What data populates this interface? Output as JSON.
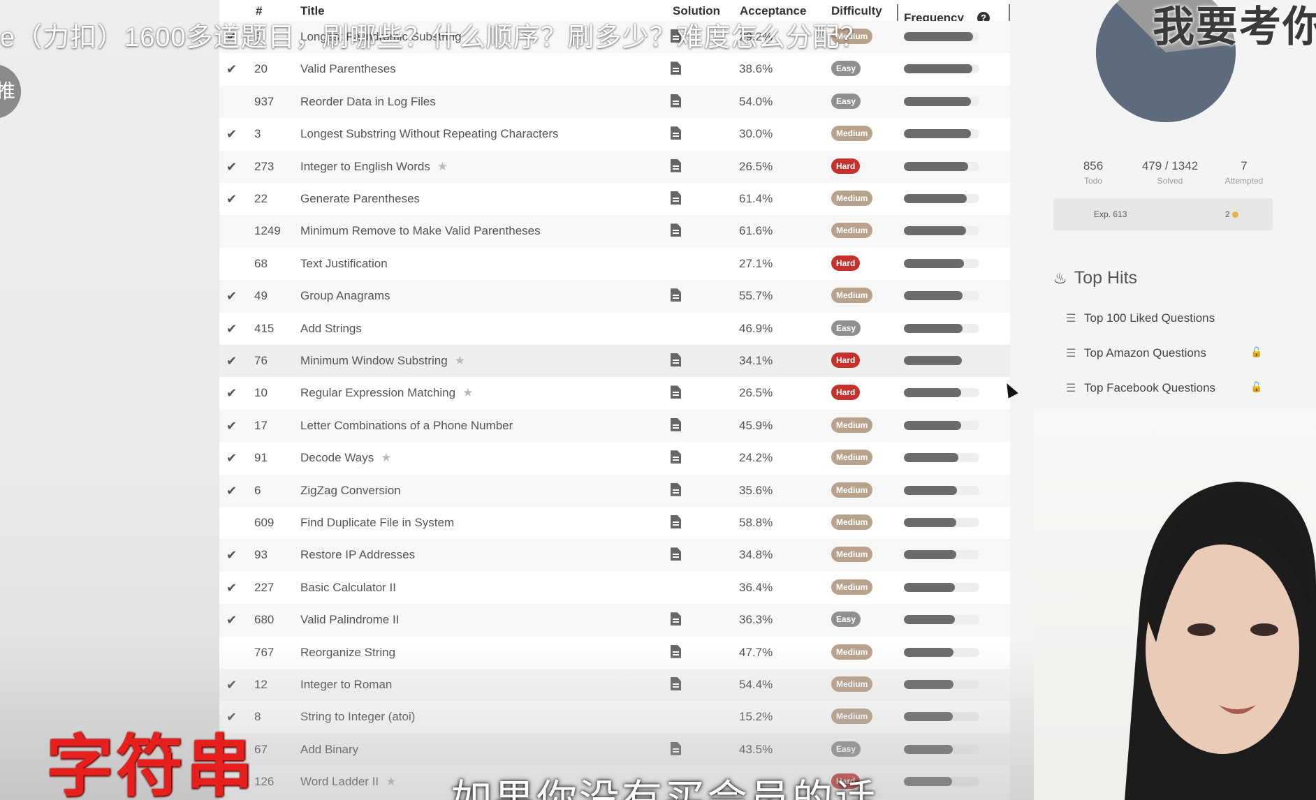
{
  "video": {
    "title_overlay": "e（力扣）1600多道题目，刷哪些？什么顺序？刷多少？难度怎么分配？",
    "side_button_char": "推",
    "top_right_caption": "我要考你",
    "red_caption": "字符串",
    "bottom_caption": "如果你没有买会员的话"
  },
  "table": {
    "headers": {
      "num": "#",
      "title": "Title",
      "solution": "Solution",
      "acceptance": "Acceptance",
      "difficulty": "Difficulty",
      "frequency": "Frequency",
      "frequency_help_icon": "question-circle-icon"
    },
    "rows": [
      {
        "solved": true,
        "num": "5",
        "title": "Longest Palindromic Substring",
        "starred": false,
        "solution": true,
        "acceptance": "29.2%",
        "difficulty": "Medium",
        "frequency": 0.92
      },
      {
        "solved": true,
        "num": "20",
        "title": "Valid Parentheses",
        "starred": false,
        "solution": true,
        "acceptance": "38.6%",
        "difficulty": "Easy",
        "frequency": 0.91
      },
      {
        "solved": false,
        "num": "937",
        "title": "Reorder Data in Log Files",
        "starred": false,
        "solution": true,
        "acceptance": "54.0%",
        "difficulty": "Easy",
        "frequency": 0.89
      },
      {
        "solved": true,
        "num": "3",
        "title": "Longest Substring Without Repeating Characters",
        "starred": false,
        "solution": true,
        "acceptance": "30.0%",
        "difficulty": "Medium",
        "frequency": 0.89
      },
      {
        "solved": true,
        "num": "273",
        "title": "Integer to English Words",
        "starred": true,
        "solution": true,
        "acceptance": "26.5%",
        "difficulty": "Hard",
        "frequency": 0.85
      },
      {
        "solved": true,
        "num": "22",
        "title": "Generate Parentheses",
        "starred": false,
        "solution": true,
        "acceptance": "61.4%",
        "difficulty": "Medium",
        "frequency": 0.83
      },
      {
        "solved": false,
        "num": "1249",
        "title": "Minimum Remove to Make Valid Parentheses",
        "starred": false,
        "solution": true,
        "acceptance": "61.6%",
        "difficulty": "Medium",
        "frequency": 0.82
      },
      {
        "solved": false,
        "num": "68",
        "title": "Text Justification",
        "starred": false,
        "solution": false,
        "acceptance": "27.1%",
        "difficulty": "Hard",
        "frequency": 0.8
      },
      {
        "solved": true,
        "num": "49",
        "title": "Group Anagrams",
        "starred": false,
        "solution": true,
        "acceptance": "55.7%",
        "difficulty": "Medium",
        "frequency": 0.78
      },
      {
        "solved": true,
        "num": "415",
        "title": "Add Strings",
        "starred": false,
        "solution": false,
        "acceptance": "46.9%",
        "difficulty": "Easy",
        "frequency": 0.78
      },
      {
        "solved": true,
        "num": "76",
        "title": "Minimum Window Substring",
        "starred": true,
        "solution": true,
        "acceptance": "34.1%",
        "difficulty": "Hard",
        "frequency": 0.77
      },
      {
        "solved": true,
        "num": "10",
        "title": "Regular Expression Matching",
        "starred": true,
        "solution": true,
        "acceptance": "26.5%",
        "difficulty": "Hard",
        "frequency": 0.76
      },
      {
        "solved": true,
        "num": "17",
        "title": "Letter Combinations of a Phone Number",
        "starred": false,
        "solution": true,
        "acceptance": "45.9%",
        "difficulty": "Medium",
        "frequency": 0.76
      },
      {
        "solved": true,
        "num": "91",
        "title": "Decode Ways",
        "starred": true,
        "solution": true,
        "acceptance": "24.2%",
        "difficulty": "Medium",
        "frequency": 0.72
      },
      {
        "solved": true,
        "num": "6",
        "title": "ZigZag Conversion",
        "starred": false,
        "solution": true,
        "acceptance": "35.6%",
        "difficulty": "Medium",
        "frequency": 0.7
      },
      {
        "solved": false,
        "num": "609",
        "title": "Find Duplicate File in System",
        "starred": false,
        "solution": true,
        "acceptance": "58.8%",
        "difficulty": "Medium",
        "frequency": 0.69
      },
      {
        "solved": true,
        "num": "93",
        "title": "Restore IP Addresses",
        "starred": false,
        "solution": true,
        "acceptance": "34.8%",
        "difficulty": "Medium",
        "frequency": 0.69
      },
      {
        "solved": true,
        "num": "227",
        "title": "Basic Calculator II",
        "starred": false,
        "solution": false,
        "acceptance": "36.4%",
        "difficulty": "Medium",
        "frequency": 0.68
      },
      {
        "solved": true,
        "num": "680",
        "title": "Valid Palindrome II",
        "starred": false,
        "solution": true,
        "acceptance": "36.3%",
        "difficulty": "Easy",
        "frequency": 0.68
      },
      {
        "solved": false,
        "num": "767",
        "title": "Reorganize String",
        "starred": false,
        "solution": true,
        "acceptance": "47.7%",
        "difficulty": "Medium",
        "frequency": 0.66
      },
      {
        "solved": true,
        "num": "12",
        "title": "Integer to Roman",
        "starred": false,
        "solution": true,
        "acceptance": "54.4%",
        "difficulty": "Medium",
        "frequency": 0.66
      },
      {
        "solved": true,
        "num": "8",
        "title": "String to Integer (atoi)",
        "starred": false,
        "solution": false,
        "acceptance": "15.2%",
        "difficulty": "Medium",
        "frequency": 0.65
      },
      {
        "solved": false,
        "num": "67",
        "title": "Add Binary",
        "starred": false,
        "solution": true,
        "acceptance": "43.5%",
        "difficulty": "Easy",
        "frequency": 0.65
      },
      {
        "solved": false,
        "num": "126",
        "title": "Word Ladder II",
        "starred": true,
        "solution": false,
        "acceptance": "",
        "difficulty": "Hard",
        "frequency": 0.64
      }
    ]
  },
  "difficulty_colors": {
    "Easy": "#8f8f8f",
    "Medium": "#b9a28c",
    "Hard": "#c6312c"
  },
  "sidebar": {
    "progress": {
      "todo_value": "856",
      "todo_label": "Todo",
      "solved_value": "479 / 1342",
      "solved_label": "Solved",
      "attempted_value": "7",
      "attempted_label": "Attempted",
      "pie_solved_fraction": 0.357,
      "pie_colors": {
        "solved": "#5d6b7c",
        "todo": "#9a9a9a"
      }
    },
    "exp": {
      "label": "Exp. 613",
      "coins": "2"
    },
    "top_hits": {
      "title": "Top Hits",
      "items": [
        {
          "label": "Top 100 Liked Questions",
          "locked": false
        },
        {
          "label": "Top Amazon Questions",
          "locked": true
        },
        {
          "label": "Top Facebook Questions",
          "locked": true
        }
      ]
    }
  }
}
